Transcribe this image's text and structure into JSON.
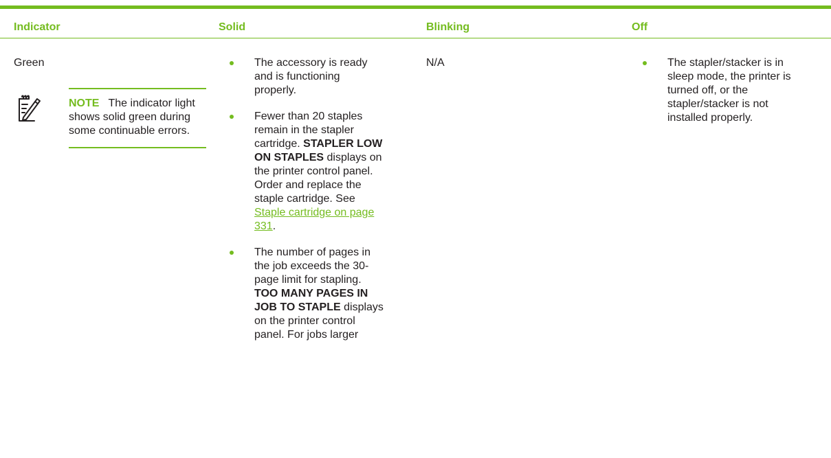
{
  "table": {
    "headers": {
      "indicator": "Indicator",
      "solid": "Solid",
      "blinking": "Blinking",
      "off": "Off"
    },
    "row": {
      "indicator": "Green",
      "note": {
        "label": "NOTE",
        "text": "The indicator light shows solid green during some continuable errors."
      },
      "solid": [
        {
          "text": "The accessory is ready and is functioning properly."
        },
        {
          "text_before": "Fewer than 20 staples remain in the stapler cartridge.",
          "bold": "STAPLER LOW ON STAPLES",
          "text_after": "displays on the printer control panel. Order and replace the staple cartridge. See",
          "link": "Staple cartridge on page 331",
          "end": "."
        },
        {
          "text_before": "The number of pages in the job exceeds the 30-page limit for stapling.",
          "bold": "TOO MANY PAGES IN JOB TO STAPLE",
          "text_after": "displays on the printer control panel. For jobs larger"
        }
      ],
      "blinking": "N/A",
      "off": [
        {
          "text": "The stapler/stacker is in sleep mode, the printer is turned off, or the stapler/stacker is not installed properly."
        }
      ]
    }
  },
  "colors": {
    "accent": "#74bc1f",
    "text": "#231f20"
  },
  "icons": {
    "note": "note-pencil-icon"
  }
}
